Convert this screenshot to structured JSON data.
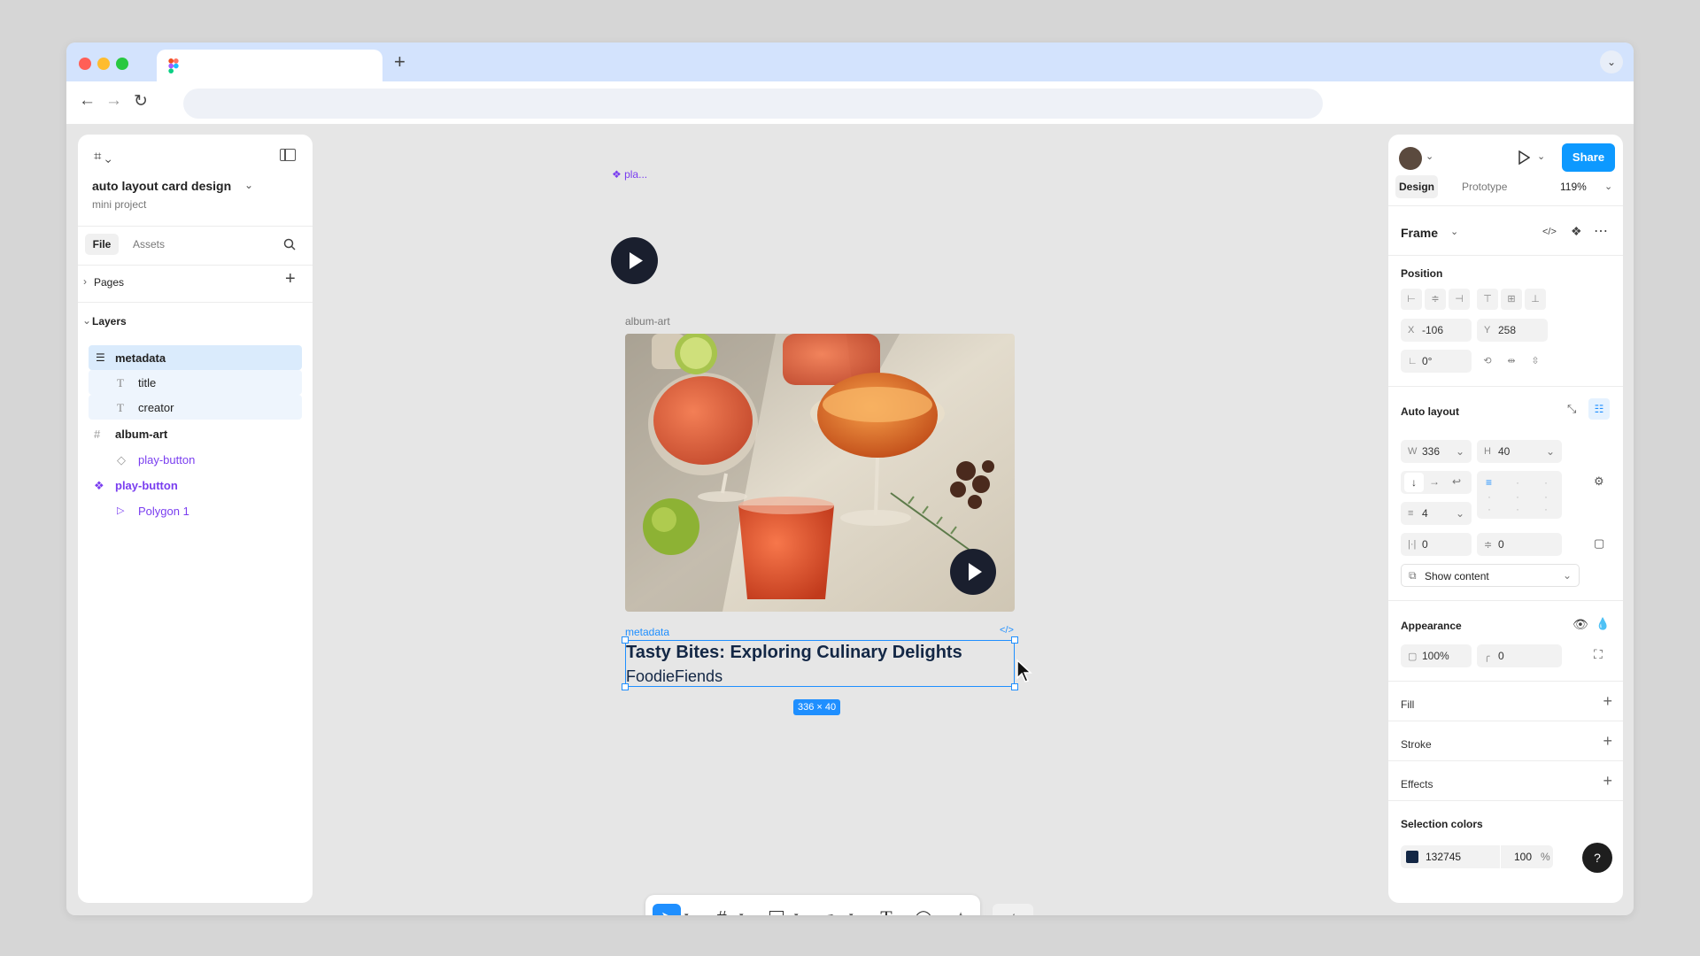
{
  "browser": {
    "new_tab_symbol": "+",
    "address_value": ""
  },
  "left_panel": {
    "project_title": "auto layout card design",
    "project_subtitle": "mini project",
    "tabs": [
      "File",
      "Assets"
    ],
    "pages_label": "Pages",
    "layers_label": "Layers",
    "layers": [
      {
        "name": "metadata",
        "depth": 0,
        "type": "auto-layout",
        "selected": true
      },
      {
        "name": "title",
        "depth": 1,
        "type": "text"
      },
      {
        "name": "creator",
        "depth": 1,
        "type": "text"
      },
      {
        "name": "album-art",
        "depth": 0,
        "type": "frame"
      },
      {
        "name": "play-button",
        "depth": 1,
        "type": "instance"
      },
      {
        "name": "play-button",
        "depth": 0,
        "type": "component"
      },
      {
        "name": "Polygon 1",
        "depth": 1,
        "type": "polygon"
      }
    ]
  },
  "canvas": {
    "component_label": "pla...",
    "album_label": "album-art",
    "metadata_label": "metadata",
    "card_title": "Tasty Bites: Exploring Culinary Delights",
    "card_creator": "FoodieFiends",
    "size_badge": "336 × 40",
    "code_icon_label": "</>"
  },
  "right_panel": {
    "share_label": "Share",
    "tabs": [
      "Design",
      "Prototype"
    ],
    "zoom": "119%",
    "selection_type": "Frame",
    "position_label": "Position",
    "x_label": "X",
    "x": "-106",
    "y_label": "Y",
    "y": "258",
    "rotation": "0°",
    "auto_layout_label": "Auto layout",
    "w_label": "W",
    "w": "336",
    "h_label": "H",
    "h": "40",
    "gap": "4",
    "padding_h": "0",
    "padding_v": "0",
    "clip_label": "Show content",
    "appearance_label": "Appearance",
    "opacity": "100%",
    "radius": "0",
    "fill_label": "Fill",
    "stroke_label": "Stroke",
    "effects_label": "Effects",
    "selection_colors_label": "Selection colors",
    "selection_color_hex": "132745",
    "selection_color_opacity": "100",
    "percent_symbol": "%",
    "help_label": "?"
  },
  "colors": {
    "accent": "#0d99ff",
    "selection_color": "#132745",
    "component_purple": "#7a3ef0"
  }
}
